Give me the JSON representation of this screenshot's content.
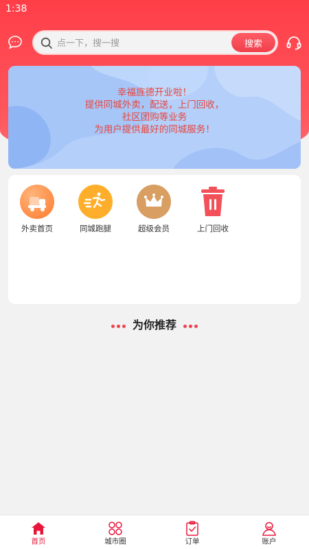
{
  "status_bar": {
    "time": "1:38"
  },
  "search": {
    "placeholder": "点一下，搜一搜",
    "button_label": "搜索"
  },
  "banner": {
    "lines": [
      "幸福旌德开业啦！",
      "提供同城外卖，配送，上门回收，",
      "社区团购等业务",
      "为用户提供最好的同城服务！"
    ]
  },
  "menu": {
    "items": [
      {
        "label": "外卖首页",
        "icon": "delivery-truck-icon"
      },
      {
        "label": "同城跑腿",
        "icon": "runner-icon"
      },
      {
        "label": "超级会员",
        "icon": "crown-icon"
      },
      {
        "label": "上门回收",
        "icon": "trash-bin-icon"
      }
    ]
  },
  "recommend": {
    "title": "为你推荐"
  },
  "tabbar": {
    "items": [
      {
        "label": "首页",
        "icon": "home-icon",
        "active": true
      },
      {
        "label": "城市圈",
        "icon": "city-circle-icon",
        "active": false
      },
      {
        "label": "订单",
        "icon": "order-clipboard-icon",
        "active": false
      },
      {
        "label": "账户",
        "icon": "account-user-icon",
        "active": false
      }
    ]
  },
  "colors": {
    "brand_red": "#ff3e48",
    "accent_red": "#e8163a",
    "banner_text": "#e8453c"
  }
}
